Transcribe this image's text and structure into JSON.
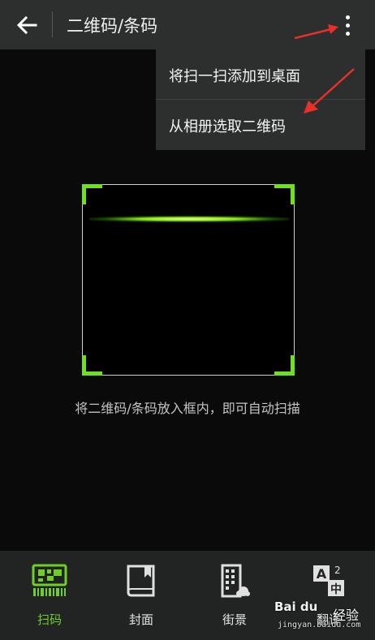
{
  "header": {
    "title": "二维码/条码",
    "back_icon": "arrow-left-icon",
    "more_icon": "more-vertical-icon"
  },
  "menu": {
    "items": [
      {
        "label": "将扫一扫添加到桌面"
      },
      {
        "label": "从相册选取二维码"
      }
    ]
  },
  "scanner": {
    "hint": "将二维码/条码放入框内，即可自动扫描",
    "accent_color": "#6ee21a"
  },
  "tabs": [
    {
      "label": "扫码",
      "icon": "qr-scan-icon",
      "active": true
    },
    {
      "label": "封面",
      "icon": "book-cover-icon",
      "active": false
    },
    {
      "label": "街景",
      "icon": "street-view-icon",
      "active": false
    },
    {
      "label": "翻译",
      "icon": "translate-icon",
      "active": false
    }
  ],
  "watermark": {
    "brand_logo": "Bai du",
    "brand_text": "经验",
    "url": "jingyan.baidu.com"
  },
  "annotation_color": "#e8302a"
}
